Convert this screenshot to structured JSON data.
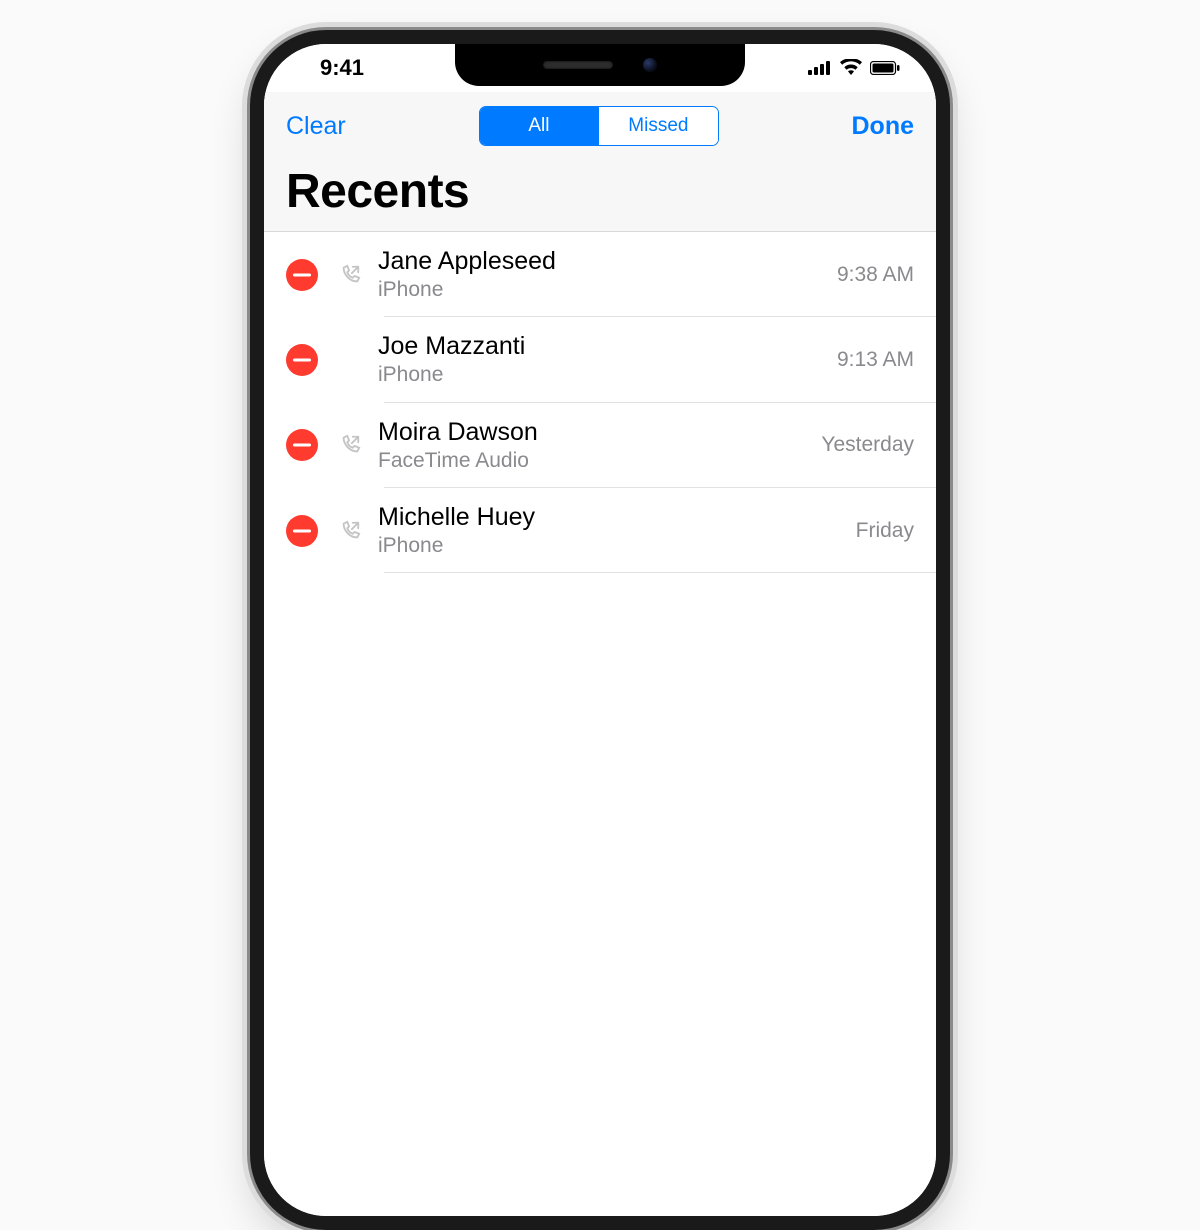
{
  "status": {
    "time": "9:41"
  },
  "nav": {
    "left": "Clear",
    "right": "Done"
  },
  "segmented": {
    "all": "All",
    "missed": "Missed",
    "active_index": 0
  },
  "title": "Recents",
  "calls": [
    {
      "name": "Jane Appleseed",
      "sub": "iPhone",
      "time": "9:38 AM",
      "outgoing": true
    },
    {
      "name": "Joe Mazzanti",
      "sub": "iPhone",
      "time": "9:13 AM",
      "outgoing": false
    },
    {
      "name": "Moira Dawson",
      "sub": "FaceTime Audio",
      "time": "Yesterday",
      "outgoing": true
    },
    {
      "name": "Michelle Huey",
      "sub": "iPhone",
      "time": "Friday",
      "outgoing": true
    }
  ]
}
